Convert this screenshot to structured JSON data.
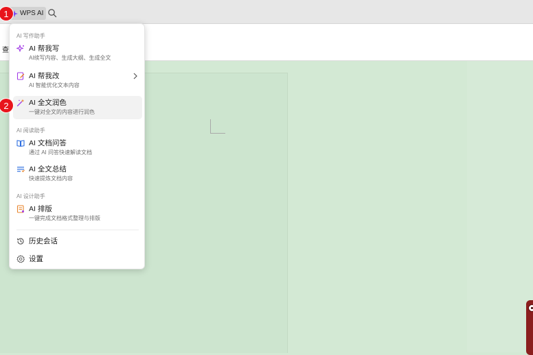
{
  "toolbar": {
    "wps_ai_label": "WPS AI",
    "ribbon_char": "查"
  },
  "menu": {
    "sections": [
      {
        "label": "AI 写作助手"
      },
      {
        "label": "AI 阅读助手"
      },
      {
        "label": "AI 设计助手"
      }
    ],
    "items": [
      {
        "title": "AI 帮我写",
        "sub": "AI续写内容、生成大纲、生成全文",
        "icon": "sparkle-icon"
      },
      {
        "title": "AI 帮我改",
        "sub": "AI 智能优化文本内容",
        "icon": "edit-doc-icon"
      },
      {
        "title": "AI 全文润色",
        "sub": "一键对全文的内容进行润色",
        "icon": "magic-wand-icon"
      },
      {
        "title": "AI 文档问答",
        "sub": "通过 AI 问答快速解读文档",
        "icon": "book-icon"
      },
      {
        "title": "AI 全文总结",
        "sub": "快速提炼文档内容",
        "icon": "summary-icon"
      },
      {
        "title": "AI 排版",
        "sub": "一键完成文档格式整理与排版",
        "icon": "layout-icon"
      }
    ],
    "history_label": "历史会话",
    "settings_label": "设置"
  },
  "badges": {
    "one": "1",
    "two": "2"
  },
  "colors": {
    "accent_purple": "#a23be6",
    "accent_blue": "#2f6fe0",
    "accent_orange": "#e8842c",
    "badge_red": "#e8141b",
    "doc_bg": "#d3e9d4"
  }
}
